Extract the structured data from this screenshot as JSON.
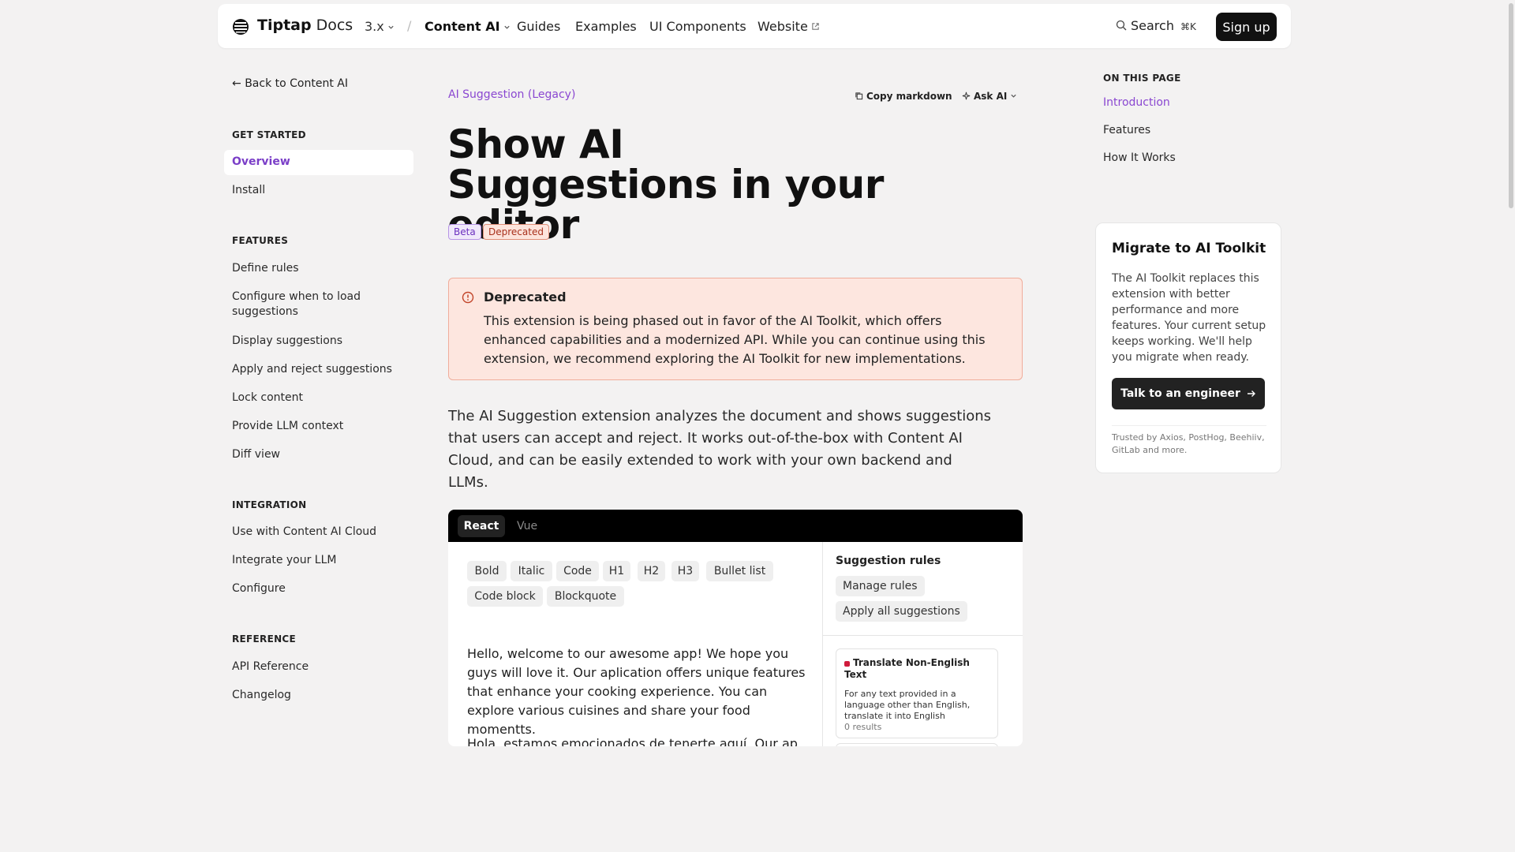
{
  "header": {
    "brand": "Tiptap",
    "brand_suffix": "Docs",
    "version": "3.x",
    "separator": "/",
    "nav": {
      "content_ai": "Content AI",
      "guides": "Guides",
      "examples": "Examples",
      "ui_components": "UI Components",
      "website": "Website"
    },
    "search_label": "Search",
    "search_shortcut": "⌘K",
    "signup_label": "Sign up"
  },
  "sidebar": {
    "back_label": "Back to Content AI",
    "sections": {
      "get_started": "GET STARTED",
      "features": "FEATURES",
      "integration": "INTEGRATION",
      "reference": "REFERENCE"
    },
    "items": {
      "overview": "Overview",
      "install": "Install",
      "define_rules": "Define rules",
      "configure_when": "Configure when to load suggestions",
      "display_suggestions": "Display suggestions",
      "apply_reject": "Apply and reject suggestions",
      "lock_content": "Lock content",
      "provide_llm": "Provide LLM context",
      "diff_view": "Diff view",
      "use_cloud": "Use with Content AI Cloud",
      "integrate_llm": "Integrate your LLM",
      "configure": "Configure",
      "api_reference": "API Reference",
      "changelog": "Changelog"
    }
  },
  "main": {
    "breadcrumb": "AI Suggestion (Legacy)",
    "copy_markdown": "Copy markdown",
    "ask_ai": "Ask AI",
    "title": "Show AI Suggestions in your editor",
    "badges": {
      "beta": "Beta",
      "deprecated": "Deprecated"
    },
    "callout": {
      "title": "Deprecated",
      "body": "This extension is being phased out in favor of the AI Toolkit, which offers enhanced capabilities and a modernized API. While you can continue using this extension, we recommend exploring the AI Toolkit for new implementations."
    },
    "intro": "The AI Suggestion extension analyzes the document and shows suggestions that users can accept and reject. It works out-of-the-box with Content AI Cloud, and can be easily extended to work with your own backend and LLMs."
  },
  "demo": {
    "tabs": {
      "react": "React",
      "vue": "Vue"
    },
    "toolbar": {
      "bold": "Bold",
      "italic": "Italic",
      "code": "Code",
      "h1": "H1",
      "h2": "H2",
      "h3": "H3",
      "bullet_list": "Bullet list",
      "code_block": "Code block",
      "blockquote": "Blockquote"
    },
    "editor": {
      "p1": "Hello, welcome to our awesome app! We hope you guys will love it. Our aplication offers unique features that enhance your cooking experience. You can explore various cuisines and share your food momentts.",
      "p2": "Hola, estamos emocionados de tenerte aquí. Our ap"
    },
    "rules": {
      "title": "Suggestion rules",
      "manage": "Manage rules",
      "apply_all": "Apply all suggestions",
      "card": {
        "title": "Translate Non-English Text",
        "desc": "For any text provided in a language other than English, translate it into English",
        "count": "0 results"
      }
    }
  },
  "toc": {
    "title": "ON THIS PAGE",
    "items": {
      "introduction": "Introduction",
      "features": "Features",
      "how": "How It Works"
    }
  },
  "migrate": {
    "title": "Migrate to AI Toolkit",
    "body": "The AI Toolkit replaces this extension with better performance and more features. Your current setup keeps working. We'll help you migrate when ready.",
    "cta": "Talk to an engineer",
    "trust": "Trusted by Axios, PostHog, Beehiiv, GitLab and more."
  },
  "colors": {
    "accent": "#8a47d1",
    "callout_bg": "#fde6df",
    "dark": "#111111"
  }
}
